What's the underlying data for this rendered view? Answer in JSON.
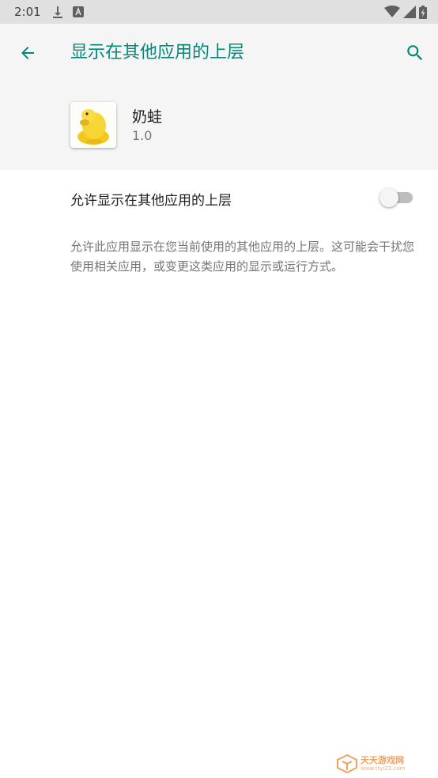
{
  "status_bar": {
    "time": "2:01",
    "icons": [
      "download-icon",
      "a-notification-icon",
      "wifi-icon",
      "signal-icon",
      "battery-icon"
    ]
  },
  "header": {
    "title": "显示在其他应用的上层",
    "back_icon": "arrow-left-icon",
    "search_icon": "search-icon",
    "accent_color": "#00897b"
  },
  "app": {
    "name": "奶蛙",
    "version": "1.0"
  },
  "permission": {
    "label": "允许显示在其他应用的上层",
    "enabled": false,
    "description": "允许此应用显示在您当前使用的其他应用的上层。这可能会干扰您使用相关应用，或变更这类应用的显示或运行方式。"
  },
  "watermark": {
    "name": "天天游戏网",
    "url": "www.ttyl23.com"
  }
}
